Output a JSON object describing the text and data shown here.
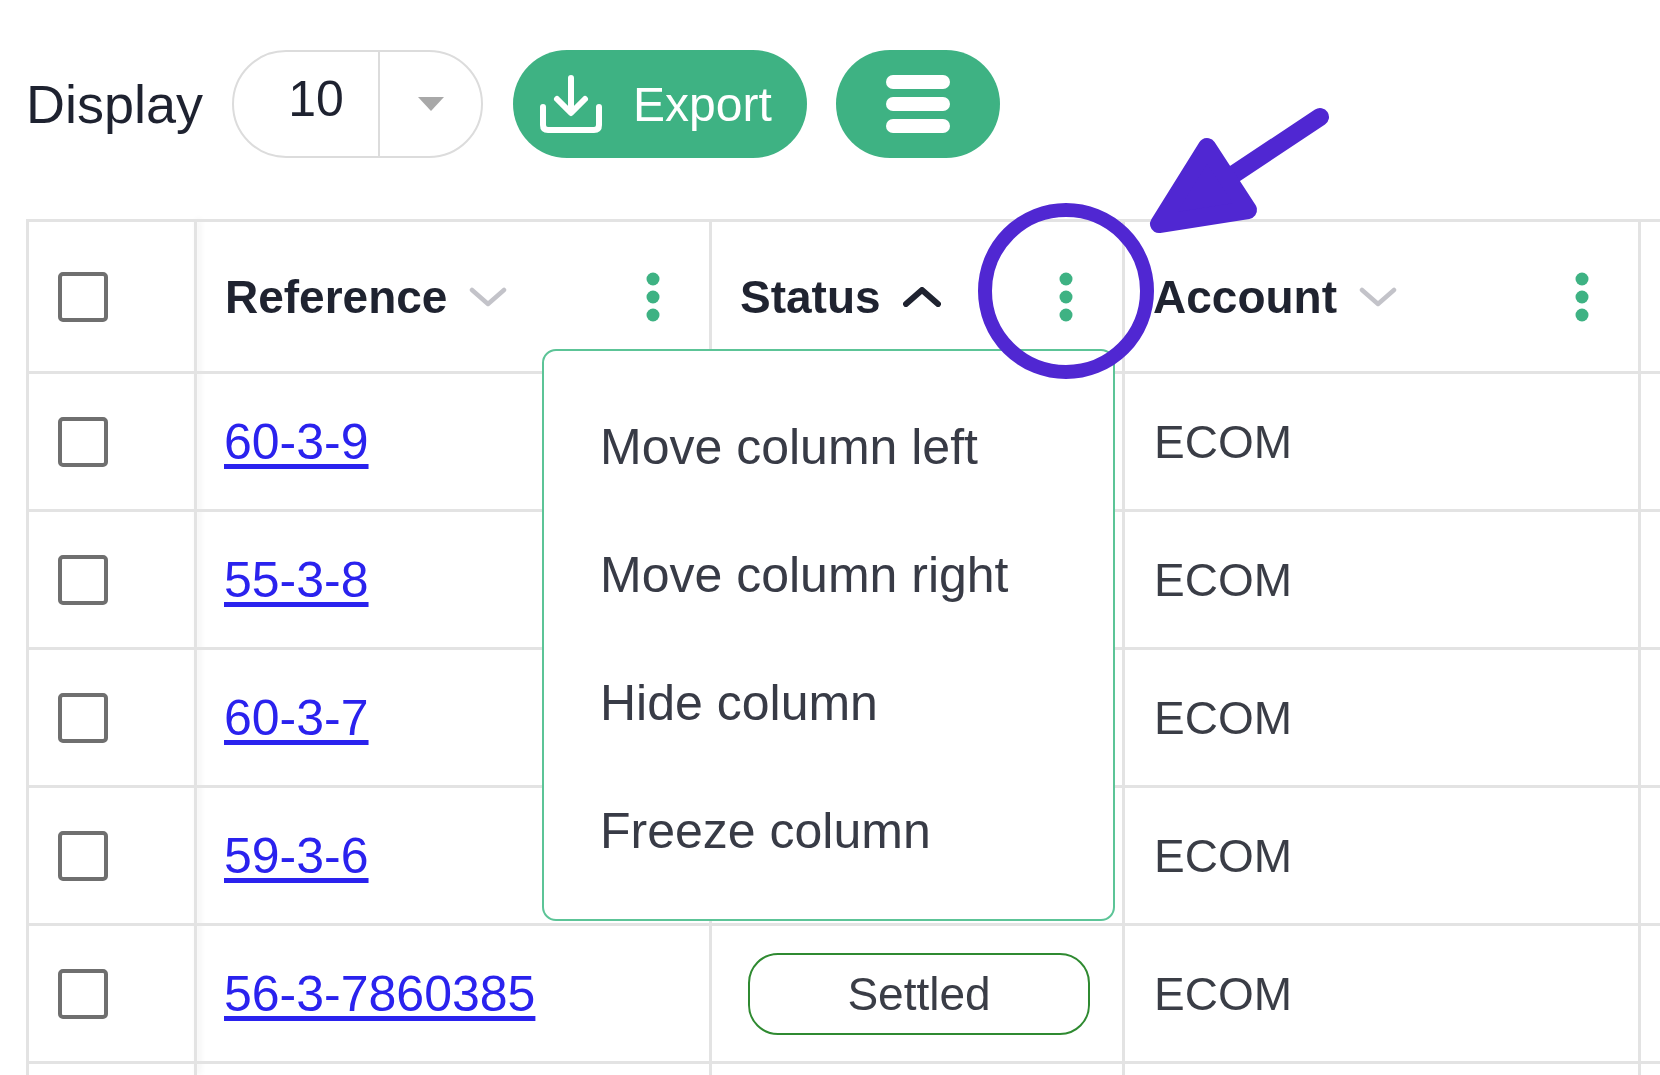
{
  "toolbar": {
    "display_label": "Display",
    "page_size": {
      "value": "10"
    },
    "export_button": "Export"
  },
  "table": {
    "select_all": {
      "checked": false
    },
    "columns": [
      {
        "label": "Reference",
        "sorted": false,
        "menu_open": false,
        "highlighted": false
      },
      {
        "label": "Status",
        "sorted": true,
        "descending": false,
        "menu_open": true,
        "highlighted": true
      },
      {
        "label": "Account",
        "sorted": false,
        "menu_open": false,
        "highlighted": false
      }
    ],
    "rows": [
      {
        "checked": false,
        "reference": "60-3-9",
        "account": "ECOM"
      },
      {
        "checked": false,
        "reference": "55-3-8",
        "account": "ECOM"
      },
      {
        "checked": false,
        "reference": "60-3-7",
        "account": "ECOM"
      },
      {
        "checked": false,
        "reference": "59-3-6",
        "account": "ECOM"
      },
      {
        "checked": false,
        "reference": "56-3-7860385",
        "status": "Settled",
        "account": "ECOM"
      }
    ]
  },
  "column_menu": {
    "items": [
      "Move column left",
      "Move column right",
      "Hide column",
      "Freeze column"
    ]
  }
}
